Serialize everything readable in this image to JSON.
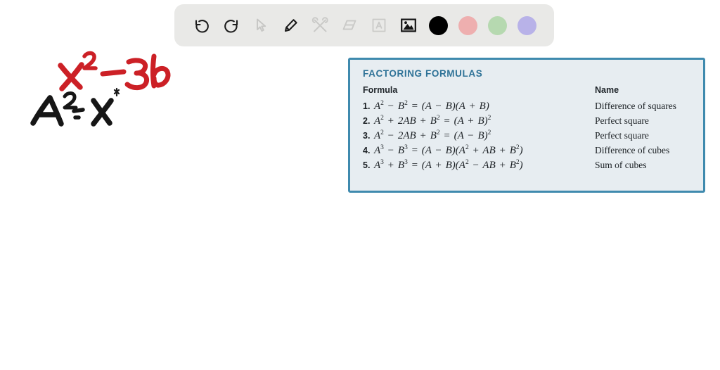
{
  "toolbar": {
    "tools": [
      {
        "name": "undo-icon",
        "label": "Undo",
        "state": "enabled"
      },
      {
        "name": "redo-icon",
        "label": "Redo",
        "state": "enabled"
      },
      {
        "name": "select-icon",
        "label": "Select",
        "state": "inactive"
      },
      {
        "name": "pencil-icon",
        "label": "Pencil",
        "state": "active"
      },
      {
        "name": "tools-icon",
        "label": "Tools",
        "state": "inactive"
      },
      {
        "name": "eraser-icon",
        "label": "Eraser",
        "state": "inactive"
      },
      {
        "name": "text-icon",
        "label": "Text",
        "state": "inactive"
      },
      {
        "name": "image-icon",
        "label": "Image",
        "state": "active"
      }
    ],
    "colors": [
      {
        "name": "color-black",
        "label": "Black",
        "hex": "#000000",
        "selected": true
      },
      {
        "name": "color-pink",
        "label": "Pink",
        "hex": "#eeafaf",
        "selected": false
      },
      {
        "name": "color-green",
        "label": "Green",
        "hex": "#b6d9b0",
        "selected": false
      },
      {
        "name": "color-purple",
        "label": "Purple",
        "hex": "#b8b2e8",
        "selected": false
      }
    ]
  },
  "card": {
    "title": "FACTORING FORMULAS",
    "accent_hex": "#3f8aae",
    "title_hex": "#2e7297",
    "background_hex": "#e7edf1",
    "headers": {
      "formula": "Formula",
      "name": "Name"
    },
    "rows": [
      {
        "num": "1.",
        "formula": "A² − B² = (A − B)(A + B)",
        "name": "Difference of squares"
      },
      {
        "num": "2.",
        "formula": "A² + 2AB + B² = (A + B)²",
        "name": "Perfect square"
      },
      {
        "num": "3.",
        "formula": "A² − 2AB + B² = (A − B)²",
        "name": "Perfect square"
      },
      {
        "num": "4.",
        "formula": "A³ − B³ = (A − B)(A² + AB + B²)",
        "name": "Difference of cubes"
      },
      {
        "num": "5.",
        "formula": "A³ + B³ = (A + B)(A² − AB + B²)",
        "name": "Sum of cubes"
      }
    ]
  },
  "annotations": [
    {
      "name": "red-expression",
      "text": "x² − 36",
      "color_hex": "#cc2026"
    },
    {
      "name": "black-expression",
      "text": "A² = x",
      "color_hex": "#111111"
    }
  ]
}
